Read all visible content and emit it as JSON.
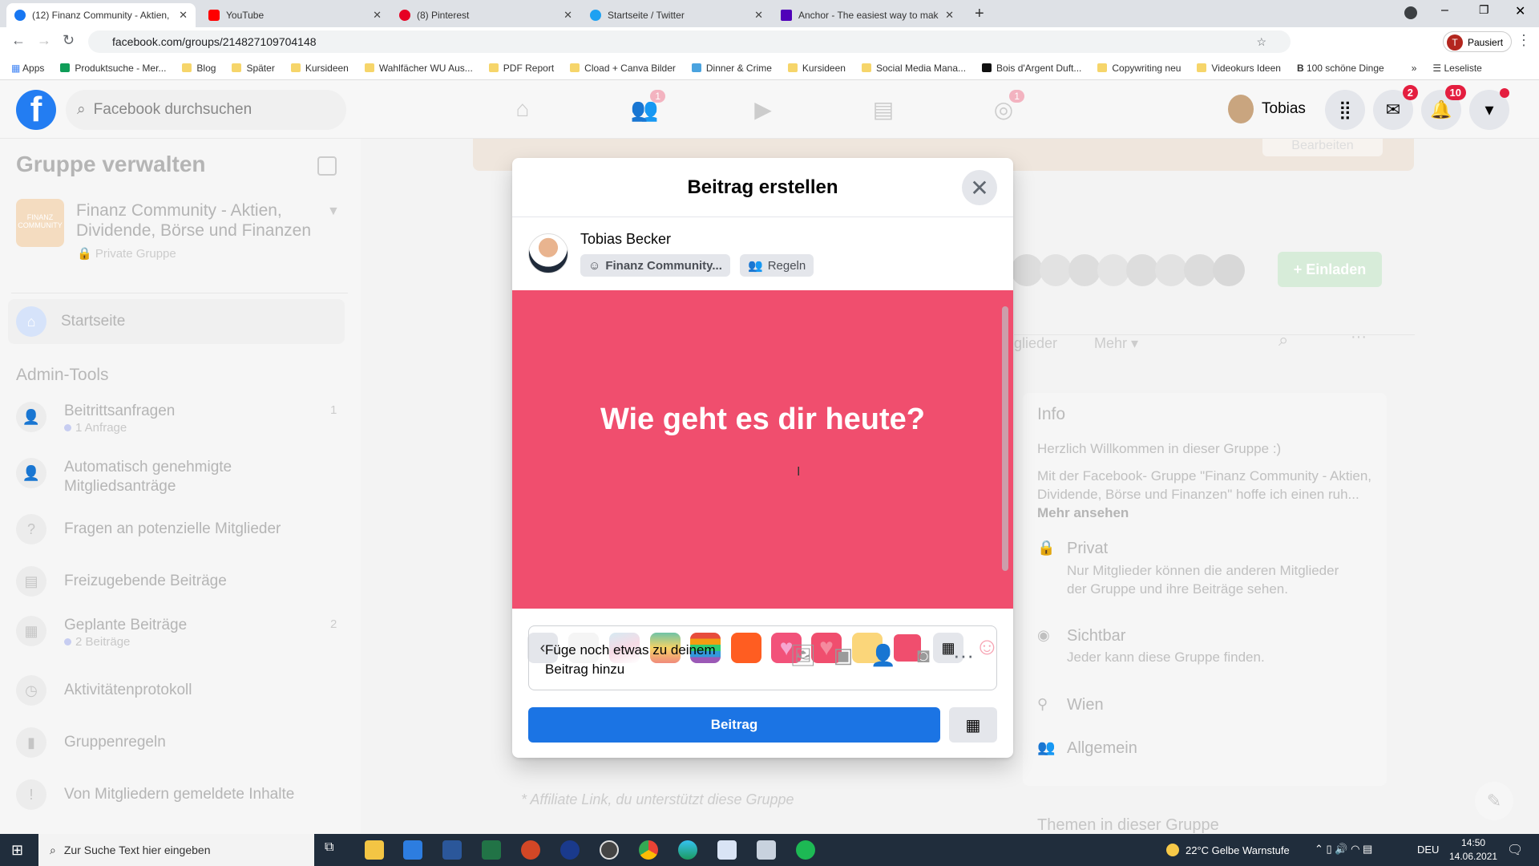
{
  "browser": {
    "tabs": [
      {
        "title": "(12) Finanz Community - Aktien,",
        "color": "#1877f2"
      },
      {
        "title": "YouTube",
        "color": "#ff0000"
      },
      {
        "title": "(8) Pinterest",
        "color": "#e60023"
      },
      {
        "title": "Startseite / Twitter",
        "color": "#1da1f2"
      },
      {
        "title": "Anchor - The easiest way to mak",
        "color": "#5000b9"
      }
    ],
    "new_tab": "+",
    "url": "facebook.com/groups/214827109704148",
    "profile": "Pausiert",
    "profile_initial": "T",
    "bookmarks": [
      "Apps",
      "Produktsuche - Mer...",
      "Blog",
      "Später",
      "Kursideen",
      "Wahlfächer WU Aus...",
      "PDF Report",
      "Cload + Canva Bilder",
      "Dinner & Crime",
      "Kursideen",
      "Social Media Mana...",
      "Bois d'Argent Duft...",
      "Copywriting neu",
      "Videokurs Ideen",
      "100 schöne Dinge"
    ],
    "bookmarks_more": "»",
    "reading_list": "Leseliste"
  },
  "header": {
    "search_placeholder": "Facebook durchsuchen",
    "friends_badge": "1",
    "groups_badge": "1",
    "user": "Tobias",
    "messenger_badge": "2",
    "notifications_badge": "10"
  },
  "sidebar": {
    "title": "Gruppe verwalten",
    "group_name": "Finanz Community - Aktien, Dividende, Börse und Finanzen",
    "group_logo": "FINANZ COMMUNITY",
    "privacy": "Private Gruppe",
    "home": "Startseite",
    "section": "Admin-Tools",
    "items": [
      {
        "label": "Beitrittsanfragen",
        "sub": "1 Anfrage",
        "count": "1"
      },
      {
        "label": "Automatisch genehmigte Mitgliedsanträge"
      },
      {
        "label": "Fragen an potenzielle Mitglieder"
      },
      {
        "label": "Freizugebende Beiträge"
      },
      {
        "label": "Geplante Beiträge",
        "sub": "2 Beiträge",
        "count": "2"
      },
      {
        "label": "Aktivitätenprotokoll"
      },
      {
        "label": "Gruppenregeln"
      },
      {
        "label": "Von Mitgliedern gemeldete Inhalte"
      }
    ]
  },
  "main": {
    "edit": "Bearbeiten",
    "invite": "+ Einladen",
    "tab_members": "glieder",
    "tab_more": "Mehr",
    "footer_note": "* Affiliate Link, du unterstützt diese Gruppe",
    "info": {
      "title": "Info",
      "welcome": "Herzlich Willkommen in dieser Gruppe :)",
      "desc": "Mit der Facebook- Gruppe \"Finanz Community - Aktien, Dividende, Börse und Finanzen\" hoffe ich einen ruh...",
      "more": "Mehr ansehen",
      "private_title": "Privat",
      "private_desc": "Nur Mitglieder können die anderen Mitglieder der Gruppe und ihre Beiträge sehen.",
      "visible_title": "Sichtbar",
      "visible_desc": "Jeder kann diese Gruppe finden.",
      "location": "Wien",
      "category": "Allgemein",
      "topics": "Themen in dieser Gruppe"
    }
  },
  "modal": {
    "title": "Beitrag erstellen",
    "author": "Tobias Becker",
    "audience": "Finanz Community...",
    "rules": "Regeln",
    "prompt": "Wie geht es dir heute?",
    "background_color": "#f04e6e",
    "add_text": "Füge noch etwas zu deinem Beitrag hinzu",
    "post_button": "Beitrag"
  },
  "taskbar": {
    "search": "Zur Suche Text hier eingeben",
    "weather": "22°C  Gelbe Warnstufe",
    "lang": "DEU",
    "time": "14:50",
    "date": "14.06.2021"
  }
}
